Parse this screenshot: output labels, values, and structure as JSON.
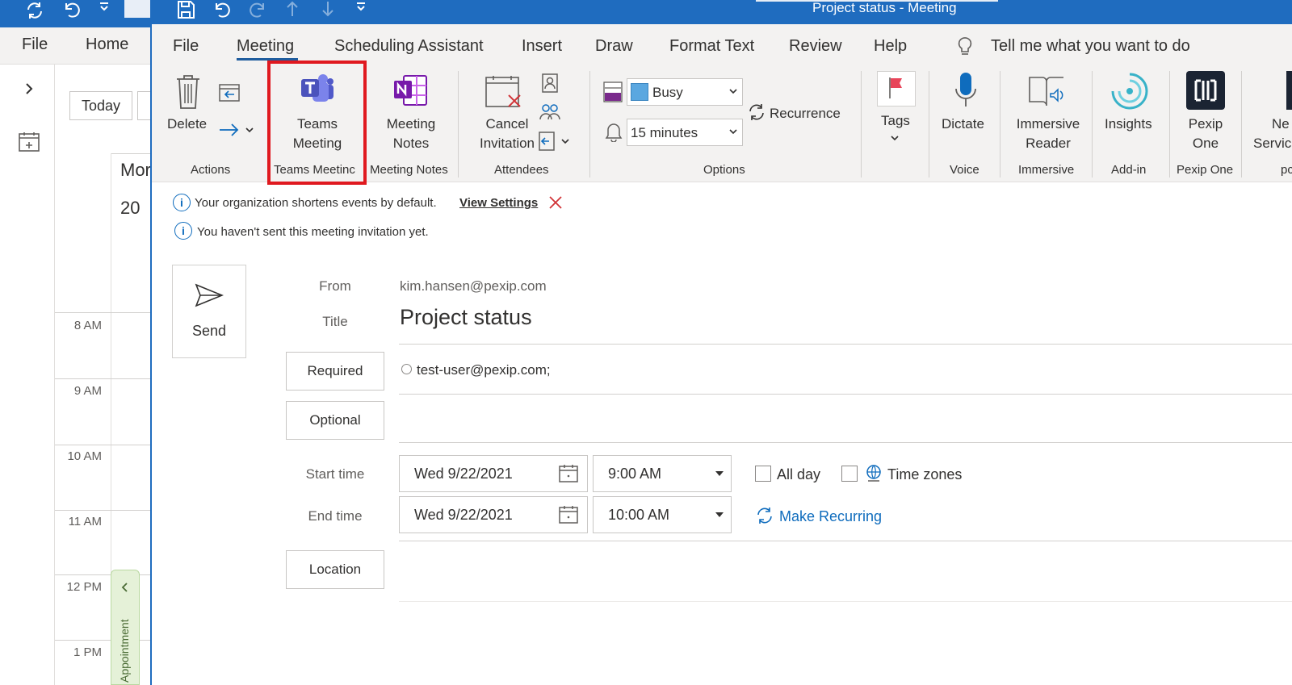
{
  "background_window": {
    "menu": [
      "File",
      "Home"
    ],
    "today_label": "Today",
    "day_name": "Mor",
    "day_number": "20",
    "times": [
      "8 AM",
      "9 AM",
      "10 AM",
      "11 AM",
      "12 PM",
      "1 PM"
    ],
    "appointment_tab": "Appointment"
  },
  "window": {
    "title": "Project status  -  Meeting"
  },
  "ribbon_tabs": [
    "File",
    "Meeting",
    "Scheduling Assistant",
    "Insert",
    "Draw",
    "Format Text",
    "Review",
    "Help"
  ],
  "tell_me": "Tell me what you want to do",
  "ribbon": {
    "delete_label": "Delete",
    "teams_line1": "Teams",
    "teams_line2": "Meeting",
    "notes_line1": "Meeting",
    "notes_line2": "Notes",
    "cancel_line1": "Cancel",
    "cancel_line2": "Invitation",
    "show_as": "Busy",
    "reminder": "15 minutes",
    "recurrence": "Recurrence",
    "tags": "Tags",
    "dictate": "Dictate",
    "immersive_line1": "Immersive",
    "immersive_line2": "Reader",
    "insights": "Insights",
    "pexip_line1": "Pexip",
    "pexip_line2": "One",
    "partial_line1": "Ne",
    "partial_line2": "Servic"
  },
  "groups": {
    "actions": "Actions",
    "teams": "Teams Meetinc",
    "notes": "Meeting Notes",
    "attendees": "Attendees",
    "options": "Options",
    "voice": "Voice",
    "immersive": "Immersive",
    "addin": "Add-in",
    "pexip": "Pexip One",
    "partial": "pc"
  },
  "info": {
    "shorten_text": "Your organization shortens events by default.",
    "view_settings": "View Settings",
    "not_sent": "You haven't sent this meeting invitation yet."
  },
  "form": {
    "send": "Send",
    "from_label": "From",
    "from_value": "kim.hansen@pexip.com",
    "title_label": "Title",
    "title_value": "Project status",
    "required": "Required",
    "required_value": "test-user@pexip.com;",
    "optional": "Optional",
    "start_label": "Start time",
    "start_date": "Wed 9/22/2021",
    "start_time": "9:00 AM",
    "end_label": "End time",
    "end_date": "Wed 9/22/2021",
    "end_time": "10:00 AM",
    "all_day": "All day",
    "time_zones": "Time zones",
    "make_recurring": "Make Recurring",
    "location": "Location"
  },
  "colors": {
    "title_bar": "#1f6cbf",
    "highlight": "#e0191f",
    "link": "#0f6cbd"
  }
}
